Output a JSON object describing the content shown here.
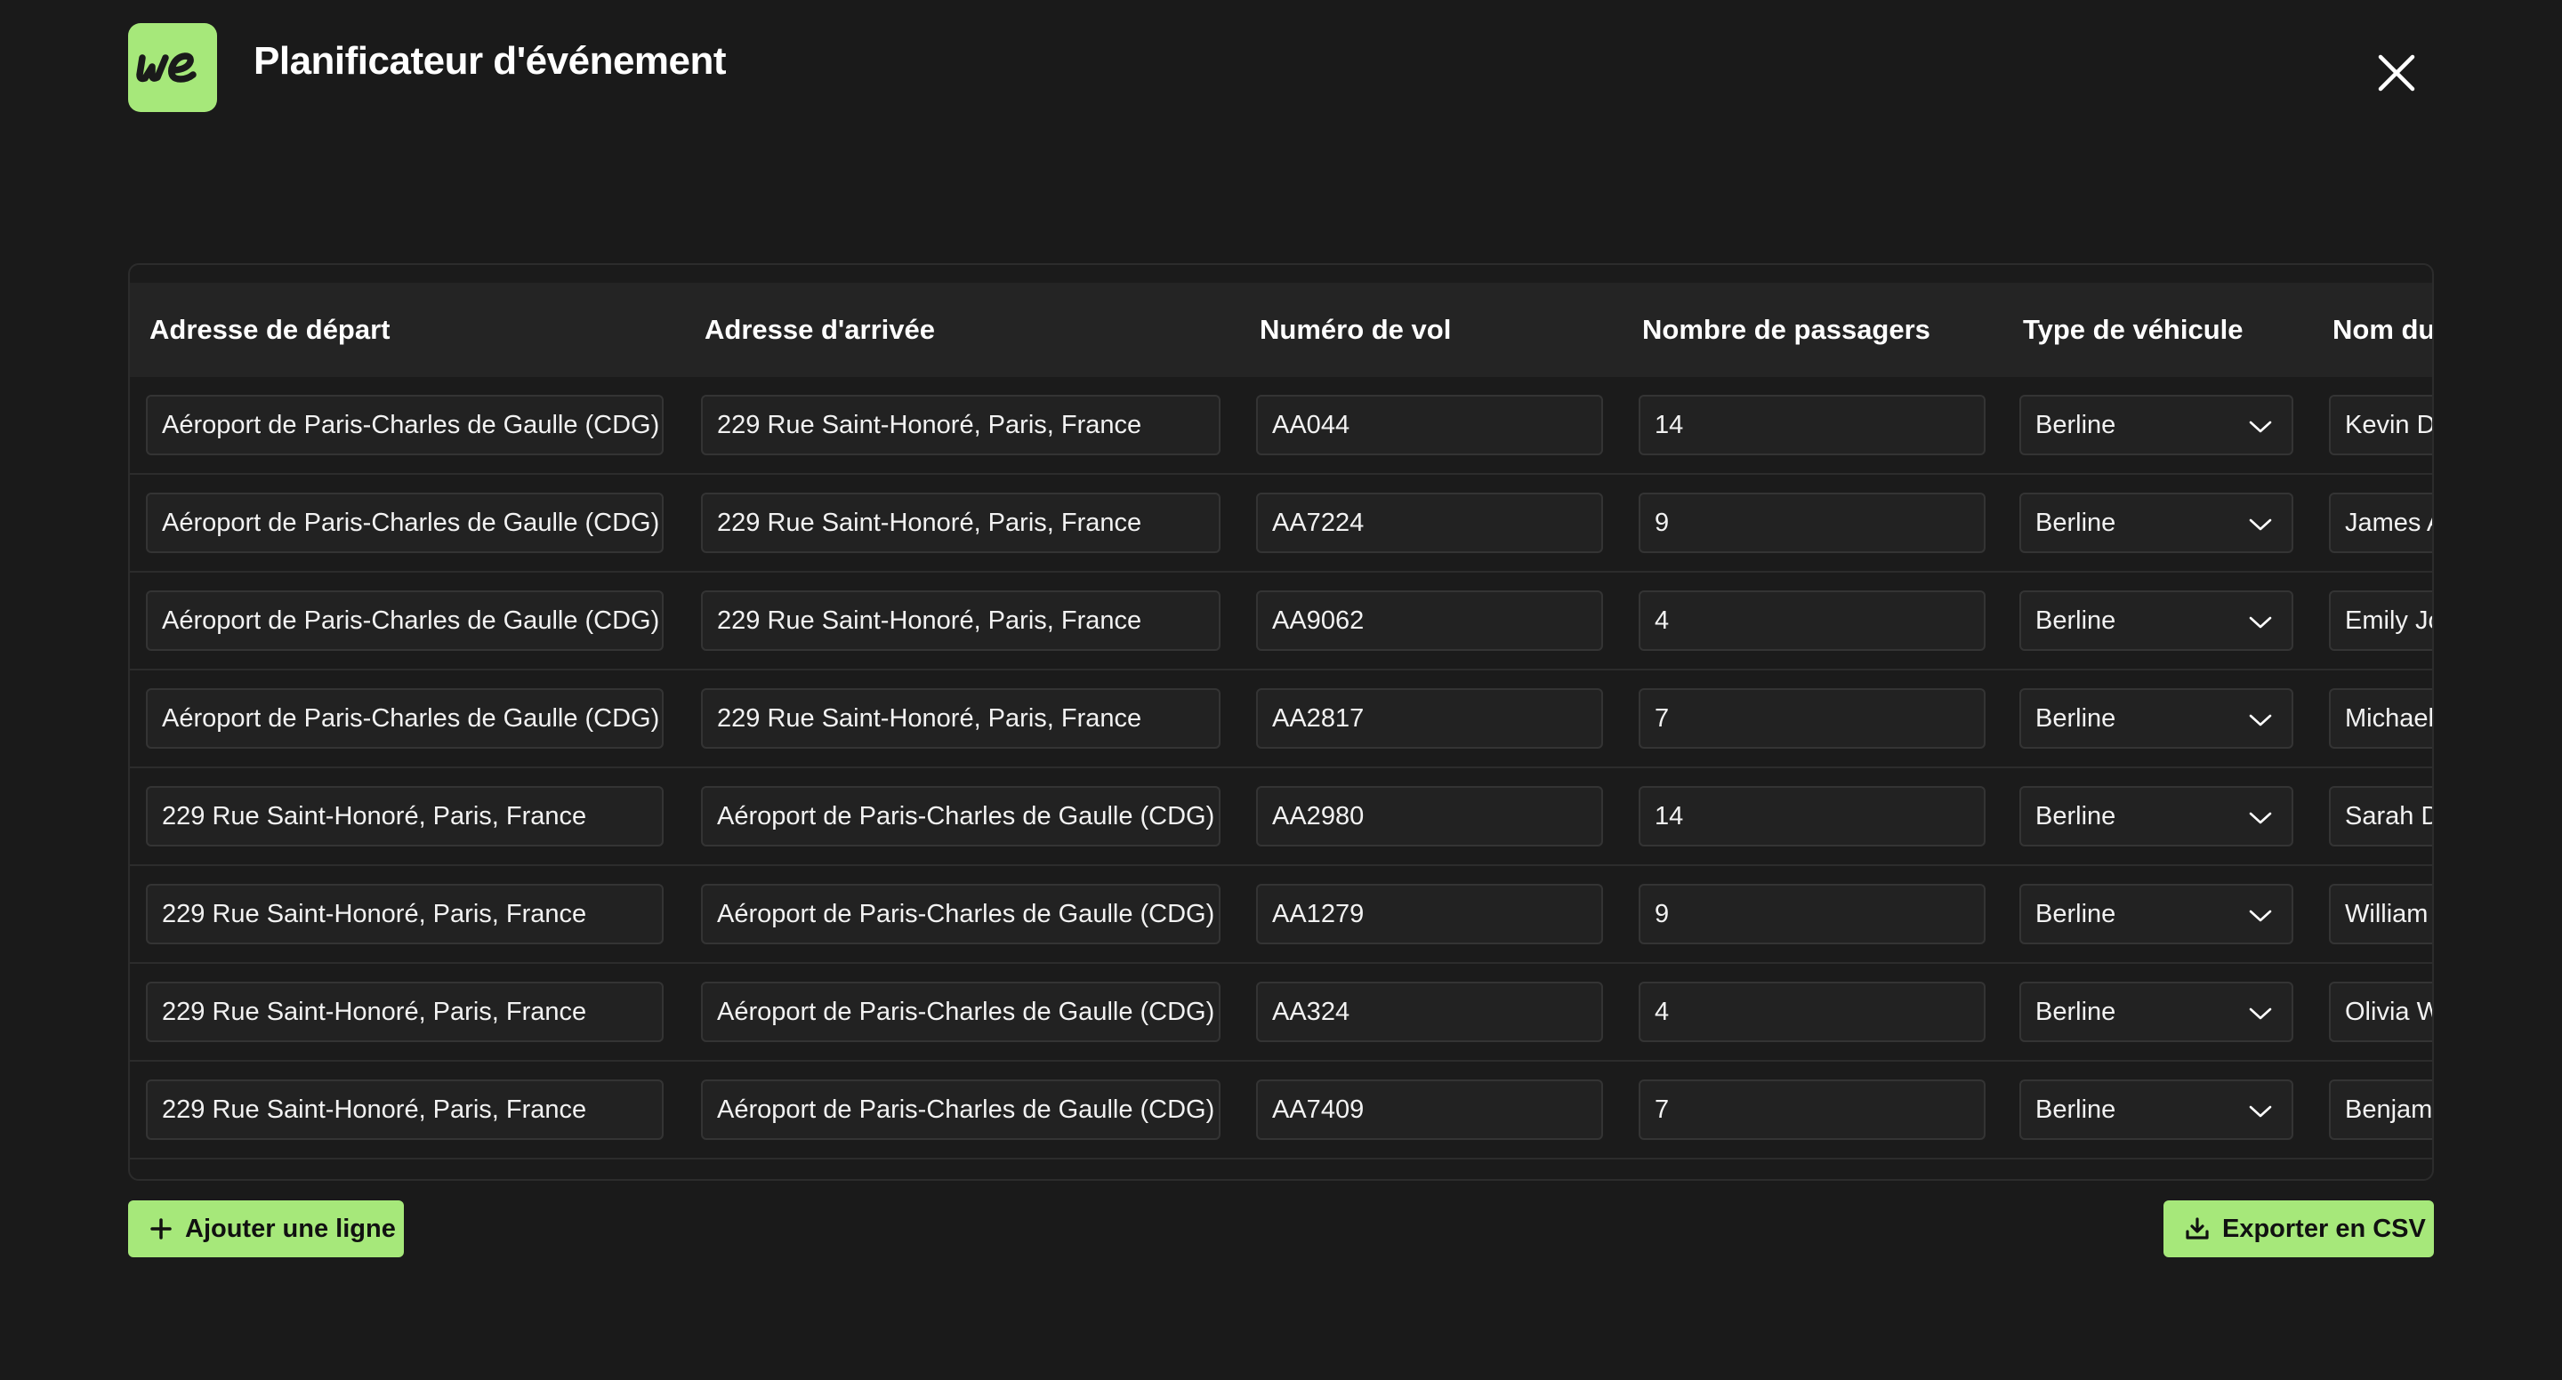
{
  "header": {
    "logo_text": "we",
    "title": "Planificateur d'événement"
  },
  "table": {
    "headers": [
      "Adresse de départ",
      "Adresse d'arrivée",
      "Numéro de vol",
      "Nombre de passagers",
      "Type de véhicule",
      "Nom du"
    ],
    "rows": [
      {
        "departure": "Aéroport de Paris-Charles de Gaulle (CDG)",
        "arrival": "229 Rue Saint-Honoré, Paris, France",
        "flight": "AA044",
        "passengers": "14",
        "vehicle": "Berline",
        "name": "Kevin Du"
      },
      {
        "departure": "Aéroport de Paris-Charles de Gaulle (CDG)",
        "arrival": "229 Rue Saint-Honoré, Paris, France",
        "flight": "AA7224",
        "passengers": "9",
        "vehicle": "Berline",
        "name": "James A"
      },
      {
        "departure": "Aéroport de Paris-Charles de Gaulle (CDG)",
        "arrival": "229 Rue Saint-Honoré, Paris, France",
        "flight": "AA9062",
        "passengers": "4",
        "vehicle": "Berline",
        "name": "Emily Jo"
      },
      {
        "departure": "Aéroport de Paris-Charles de Gaulle (CDG)",
        "arrival": "229 Rue Saint-Honoré, Paris, France",
        "flight": "AA2817",
        "passengers": "7",
        "vehicle": "Berline",
        "name": "Michael"
      },
      {
        "departure": "229 Rue Saint-Honoré, Paris, France",
        "arrival": "Aéroport de Paris-Charles de Gaulle (CDG)",
        "flight": "AA2980",
        "passengers": "14",
        "vehicle": "Berline",
        "name": "Sarah D"
      },
      {
        "departure": "229 Rue Saint-Honoré, Paris, France",
        "arrival": "Aéroport de Paris-Charles de Gaulle (CDG)",
        "flight": "AA1279",
        "passengers": "9",
        "vehicle": "Berline",
        "name": "William"
      },
      {
        "departure": "229 Rue Saint-Honoré, Paris, France",
        "arrival": "Aéroport de Paris-Charles de Gaulle (CDG)",
        "flight": "AA324",
        "passengers": "4",
        "vehicle": "Berline",
        "name": "Olivia W"
      },
      {
        "departure": "229 Rue Saint-Honoré, Paris, France",
        "arrival": "Aéroport de Paris-Charles de Gaulle (CDG)",
        "flight": "AA7409",
        "passengers": "7",
        "vehicle": "Berline",
        "name": "Benjami"
      }
    ]
  },
  "actions": {
    "add_row_label": "Ajouter une ligne",
    "export_label": "Exporter en CSV"
  },
  "icons": {
    "close": "close-icon",
    "chevron": "chevron-down-icon",
    "plus": "plus-icon",
    "download": "download-icon"
  },
  "colors": {
    "accent": "#a6e87a",
    "background": "#1a1a1a",
    "header_row": "#242424",
    "input_bg": "#222222"
  }
}
